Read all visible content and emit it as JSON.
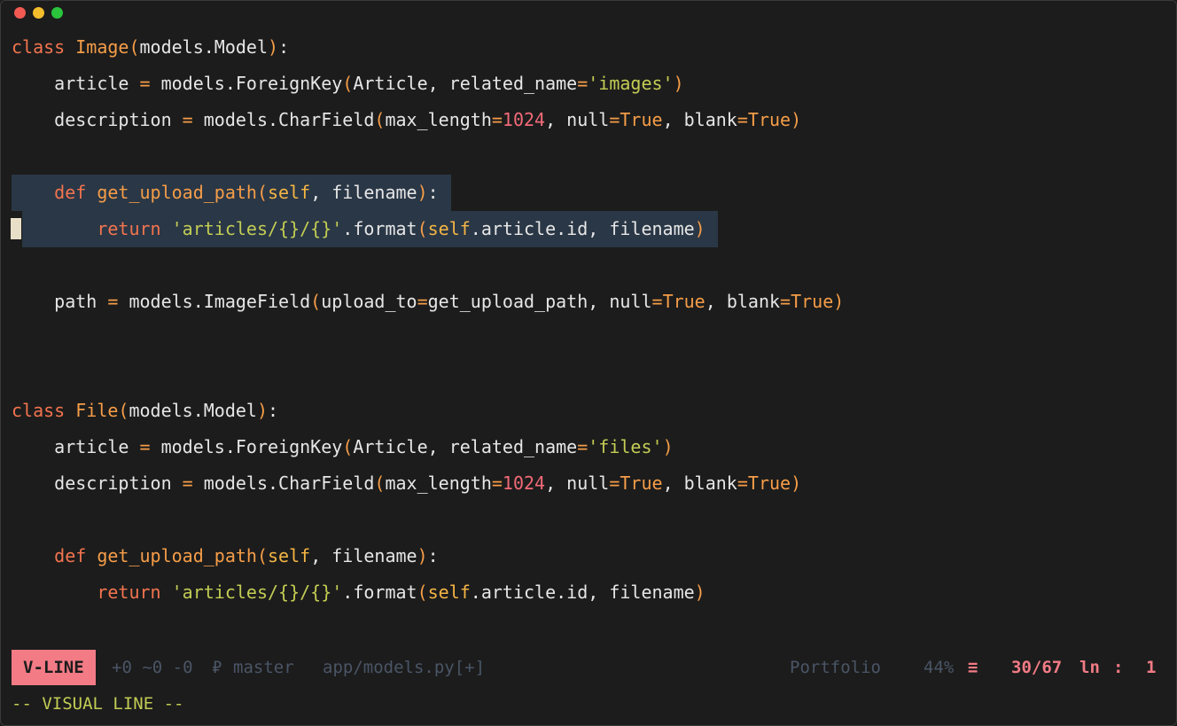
{
  "window": {
    "traffic_lights": {
      "close": "#f25a52",
      "minimize": "#f5be2d",
      "zoom": "#2bc43d"
    }
  },
  "editor": {
    "colors": {
      "background": "#1c1c1c",
      "selection": "#2a3746",
      "keyword": "#f2744f",
      "function": "#f59d48",
      "string": "#c3cd54",
      "number": "#f26a78"
    },
    "lines": [
      {
        "tokens": [
          [
            "kw",
            "class "
          ],
          [
            "fn",
            "Image"
          ],
          [
            "br",
            "("
          ],
          [
            "plain",
            "models.Model"
          ],
          [
            "br",
            ")"
          ],
          [
            "plain",
            ":"
          ]
        ]
      },
      {
        "tokens": [
          [
            "plain",
            "    article "
          ],
          [
            "op",
            "="
          ],
          [
            "plain",
            " models.ForeignKey"
          ],
          [
            "br",
            "("
          ],
          [
            "plain",
            "Article, related_name"
          ],
          [
            "op",
            "="
          ],
          [
            "str",
            "'images'"
          ],
          [
            "br",
            ")"
          ]
        ]
      },
      {
        "tokens": [
          [
            "plain",
            "    description "
          ],
          [
            "op",
            "="
          ],
          [
            "plain",
            " models.CharField"
          ],
          [
            "br",
            "("
          ],
          [
            "plain",
            "max_length"
          ],
          [
            "op",
            "="
          ],
          [
            "num",
            "1024"
          ],
          [
            "plain",
            ", null"
          ],
          [
            "op",
            "="
          ],
          [
            "bool",
            "True"
          ],
          [
            "plain",
            ", blank"
          ],
          [
            "op",
            "="
          ],
          [
            "bool",
            "True"
          ],
          [
            "br",
            ")"
          ]
        ]
      },
      {
        "tokens": []
      },
      {
        "selected": true,
        "tokens": [
          [
            "plain",
            "    "
          ],
          [
            "kw",
            "def "
          ],
          [
            "fn",
            "get_upload_path"
          ],
          [
            "br",
            "("
          ],
          [
            "self",
            "self"
          ],
          [
            "plain",
            ", filename"
          ],
          [
            "br",
            ")"
          ],
          [
            "plain",
            ":"
          ]
        ]
      },
      {
        "selected": true,
        "cursor": true,
        "tokens": [
          [
            "plain",
            "        "
          ],
          [
            "kw",
            "return "
          ],
          [
            "str",
            "'articles/{}/{}'"
          ],
          [
            "plain",
            ".format"
          ],
          [
            "br",
            "("
          ],
          [
            "self",
            "self"
          ],
          [
            "plain",
            ".article.id, filename"
          ],
          [
            "br",
            ")"
          ]
        ]
      },
      {
        "tokens": []
      },
      {
        "tokens": [
          [
            "plain",
            "    path "
          ],
          [
            "op",
            "="
          ],
          [
            "plain",
            " models.ImageField"
          ],
          [
            "br",
            "("
          ],
          [
            "plain",
            "upload_to"
          ],
          [
            "op",
            "="
          ],
          [
            "plain",
            "get_upload_path, null"
          ],
          [
            "op",
            "="
          ],
          [
            "bool",
            "True"
          ],
          [
            "plain",
            ", blank"
          ],
          [
            "op",
            "="
          ],
          [
            "bool",
            "True"
          ],
          [
            "br",
            ")"
          ]
        ]
      },
      {
        "tokens": []
      },
      {
        "tokens": []
      },
      {
        "tokens": [
          [
            "kw",
            "class "
          ],
          [
            "fn",
            "File"
          ],
          [
            "br",
            "("
          ],
          [
            "plain",
            "models.Model"
          ],
          [
            "br",
            ")"
          ],
          [
            "plain",
            ":"
          ]
        ]
      },
      {
        "tokens": [
          [
            "plain",
            "    article "
          ],
          [
            "op",
            "="
          ],
          [
            "plain",
            " models.ForeignKey"
          ],
          [
            "br",
            "("
          ],
          [
            "plain",
            "Article, related_name"
          ],
          [
            "op",
            "="
          ],
          [
            "str",
            "'files'"
          ],
          [
            "br",
            ")"
          ]
        ]
      },
      {
        "tokens": [
          [
            "plain",
            "    description "
          ],
          [
            "op",
            "="
          ],
          [
            "plain",
            " models.CharField"
          ],
          [
            "br",
            "("
          ],
          [
            "plain",
            "max_length"
          ],
          [
            "op",
            "="
          ],
          [
            "num",
            "1024"
          ],
          [
            "plain",
            ", null"
          ],
          [
            "op",
            "="
          ],
          [
            "bool",
            "True"
          ],
          [
            "plain",
            ", blank"
          ],
          [
            "op",
            "="
          ],
          [
            "bool",
            "True"
          ],
          [
            "br",
            ")"
          ]
        ]
      },
      {
        "tokens": []
      },
      {
        "tokens": [
          [
            "plain",
            "    "
          ],
          [
            "kw",
            "def "
          ],
          [
            "fn",
            "get_upload_path"
          ],
          [
            "br",
            "("
          ],
          [
            "self",
            "self"
          ],
          [
            "plain",
            ", filename"
          ],
          [
            "br",
            ")"
          ],
          [
            "plain",
            ":"
          ]
        ]
      },
      {
        "tokens": [
          [
            "plain",
            "        "
          ],
          [
            "kw",
            "return "
          ],
          [
            "str",
            "'articles/{}/{}'"
          ],
          [
            "plain",
            ".format"
          ],
          [
            "br",
            "("
          ],
          [
            "self",
            "self"
          ],
          [
            "plain",
            ".article.id, filename"
          ],
          [
            "br",
            ")"
          ]
        ]
      }
    ]
  },
  "statusbar": {
    "mode": "V-LINE",
    "git_stats": "+0 ~0 -0",
    "branch_icon": "branch-icon",
    "branch": "master",
    "file": "app/models.py[+]",
    "project": "Portfolio",
    "percent": "44%",
    "percent_icon": "menu-icon",
    "position": "30/67",
    "ln_label": "ln",
    "col_sep": ":",
    "column": "1"
  },
  "cmdline": {
    "text": "-- VISUAL LINE --"
  }
}
